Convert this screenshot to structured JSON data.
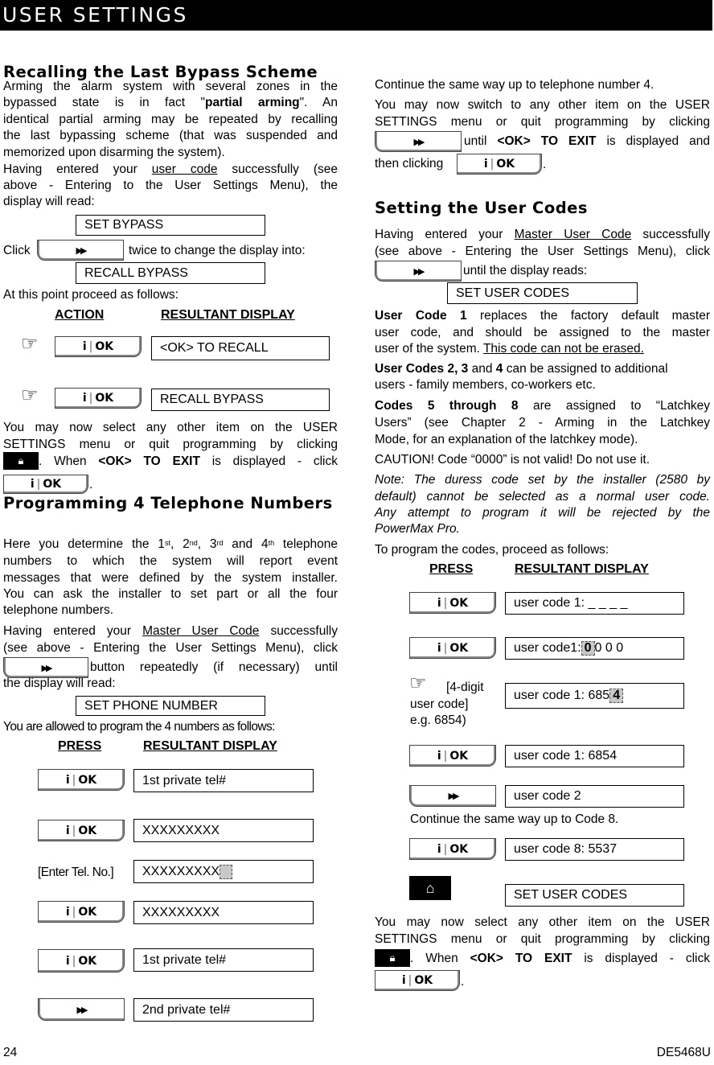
{
  "header": {
    "title": "USER SETTINGS"
  },
  "left": {
    "recall": {
      "heading": "Recalling the Last Bypass Scheme",
      "p1_lines": [
        "Arming the alarm system with several zones in the",
        "bypassed state is in fact \"",
        "partial arming",
        "\". An",
        "identical partial arming may be repeated by recalling",
        "the last bypassing scheme (that was suspended and",
        "memorized upon disarming the system)."
      ],
      "p2_a": "Having entered your ",
      "p2_link": "user code",
      "p2_b": " successfully (see",
      "p2_line2": "above - Entering to the User Settings Menu), the",
      "p2_line3": "display will read:",
      "display1": "SET BYPASS",
      "click_label": "Click",
      "twice_text": "twice to change the display into:",
      "display2": "RECALL BYPASS",
      "proceed": "At this point proceed as follows:",
      "col_action": "ACTION",
      "col_result": "RESULTANT DISPLAY",
      "rows": [
        {
          "display": "<OK> TO RECALL"
        },
        {
          "display": "RECALL BYPASS"
        }
      ],
      "p3_line1": "You may now select any other item on the USER",
      "p3_line2": "SETTINGS menu or quit programming by clicking",
      "p3_when": ". When ",
      "p3_ok": "<OK>",
      "p3_toexit": " TO EXIT",
      "p3_displayed": " is displayed - click",
      "p3_end": "."
    },
    "phone": {
      "heading": "Programming 4 Telephone Numbers",
      "p1_a": "Here you determine the 1",
      "p1_st": "st",
      "p1_b": ", 2",
      "p1_nd": "nd",
      "p1_c": ", 3",
      "p1_rd": "rd",
      "p1_d": " and 4",
      "p1_th": "th",
      "p1_e": " telephone",
      "p1_line2": "numbers to which the system will report event",
      "p1_line3": "messages that were defined by the system installer.",
      "p1_line4": "You can ask the installer to set part or all the four",
      "p1_line5": "telephone numbers.",
      "p2_a": "Having entered your ",
      "p2_link": "Master User Code",
      "p2_b": " successfully",
      "p2_line2": "(see above - Entering the User Settings Menu), click",
      "p2_button_text": " button repeatedly (if necessary) until",
      "p2_line4": "the display will read:",
      "display": "SET PHONE NUMBER",
      "allowed": "You are allowed to program the 4 numbers as follows:",
      "col_press": "PRESS",
      "col_result": "RESULTANT DISPLAY",
      "enter_tel": "[Enter Tel. No.]",
      "rows": [
        {
          "press": "ok",
          "display": "1st private tel#"
        },
        {
          "press": "ok",
          "display": "XXXXXXXXX"
        },
        {
          "press": "enter",
          "display": "XXXXXXXXX"
        },
        {
          "press": "ok",
          "display": "XXXXXXXXX"
        },
        {
          "press": "ok",
          "display": "1st private tel#"
        },
        {
          "press": "next",
          "display": "2nd private tel#"
        }
      ]
    }
  },
  "right": {
    "continue_tel": "Continue the same way up to telephone number 4.",
    "p1_line1": "You may now switch to any other item on the USER",
    "p1_line2": "SETTINGS menu or quit programming by clicking",
    "p1_until": " until ",
    "p1_ok": "<OK>",
    "p1_toexit": " TO EXIT",
    "p1_rest": " is displayed and",
    "p1_then": "then clicking",
    "p1_end": ".",
    "codes": {
      "heading": "Setting the User Codes",
      "p1_a": "Having entered your ",
      "p1_link": "Master User Code",
      "p1_b": " successfully",
      "p1_line2": "(see above - Entering the User Settings Menu), click",
      "p1_until": " until the display reads:",
      "display": "SET USER CODES",
      "uc1_bold": "User Code 1",
      "uc1_a": " replaces the factory default master",
      "uc1_line2": "user code, and should be assigned to the master",
      "uc1_line3_a": "user of the system. ",
      "uc1_line3_u": "This code can not be erased.",
      "uc2_b1": "User Codes 2, 3",
      "uc2_and": " and ",
      "uc2_b2": "4",
      "uc2_rest": " can be assigned to additional",
      "uc2_line2": "users - family members, co-workers etc.",
      "c5_bold": "Codes 5 through 8",
      "c5_rest": " are assigned to “Latchkey",
      "c5_line2": "Users” (see Chapter 2 - Arming in the Latchkey",
      "c5_line3": "Mode, for an explanation of the latchkey mode).",
      "caution": "CAUTION! Code “0000” is not valid! Do not use it.",
      "note_line1": "Note: The duress code set by the installer (2580 by",
      "note_line2": "default) cannot be selected as a normal user code.",
      "note_line3": "Any attempt to program it will be rejected by the",
      "note_line4": "PowerMax Pro.",
      "proceed": "To program the codes, proceed as follows:",
      "col_press": "PRESS",
      "col_result": "RESULTANT DISPLAY",
      "digit_label_1": "[4-digit",
      "digit_label_2": "user code]",
      "digit_label_3": "e.g. 6854)",
      "rows": [
        {
          "display_a": "user code 1: _ _ _ _",
          "cursor": ""
        },
        {
          "display_a": "user code1: ",
          "cursor": "0",
          "display_b": " 0 0 0"
        },
        {
          "display_a": "user code 1: 685",
          "cursor": "4"
        },
        {
          "display_a": "user code 1: 6854"
        },
        {
          "display_a": "user code 2"
        },
        {
          "display_a": "user code 8: 5537"
        },
        {
          "display_a": "SET USER CODES"
        }
      ],
      "continue_code": "Continue the same way up to Code 8.",
      "p_end_line1": "You may now select any other item on the USER",
      "p_end_line2": "SETTINGS menu or quit programming by clicking",
      "p_end_when": ". When ",
      "p_end_ok": "<OK>",
      "p_end_toexit": " TO EXIT",
      "p_end_displayed": " is displayed - click",
      "p_end_end": "."
    }
  },
  "buttons": {
    "ok_i": "i",
    "ok_bar": "|",
    "ok_text": "OK",
    "next": "▶▶",
    "lock": "🔒",
    "home": "⌂"
  },
  "icons": {
    "hand": "☞"
  },
  "footer": {
    "page": "24",
    "doc_id": "DE5468U"
  }
}
